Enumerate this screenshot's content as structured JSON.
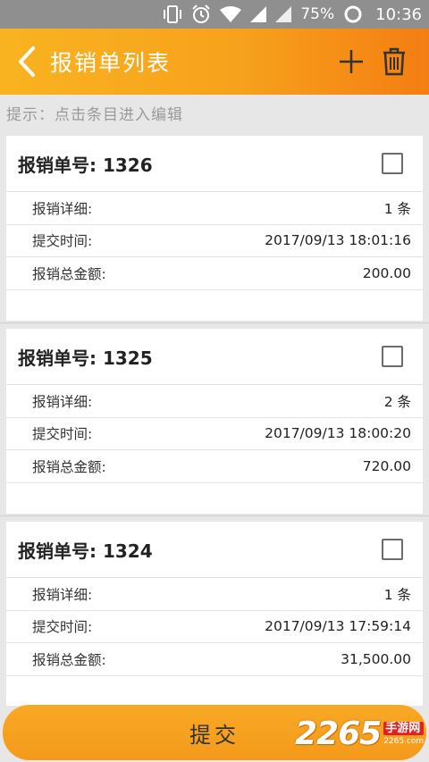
{
  "status_bar": {
    "battery": "75%",
    "time": "10:36",
    "icons": [
      "vibrate-icon",
      "alarm-icon",
      "wifi-icon",
      "signal-icon",
      "signal-icon",
      "battery-icon"
    ]
  },
  "app_bar": {
    "title": "报销单列表",
    "background": "#f7a21c",
    "icons": {
      "back": "chevron-left-icon",
      "add": "plus-icon",
      "delete": "trash-icon"
    }
  },
  "hint": "提示：点击条目进入编辑",
  "cards": [
    {
      "title": "报销单号: 1326",
      "rows": [
        {
          "label": "报销详细:",
          "value": "1 条"
        },
        {
          "label": "提交时间:",
          "value": "2017/09/13 18:01:16"
        },
        {
          "label": "报销总金额:",
          "value": "200.00"
        }
      ]
    },
    {
      "title": "报销单号: 1325",
      "rows": [
        {
          "label": "报销详细:",
          "value": "2 条"
        },
        {
          "label": "提交时间:",
          "value": "2017/09/13 18:00:20"
        },
        {
          "label": "报销总金额:",
          "value": "720.00"
        }
      ]
    },
    {
      "title": "报销单号: 1324",
      "rows": [
        {
          "label": "报销详细:",
          "value": "1 条"
        },
        {
          "label": "提交时间:",
          "value": "2017/09/13 17:59:14"
        },
        {
          "label": "报销总金额:",
          "value": "31,500.00"
        }
      ]
    }
  ],
  "submit_label": "提交",
  "watermark": {
    "number": "2265",
    "cn": "手游网",
    "url": "2265.com"
  }
}
